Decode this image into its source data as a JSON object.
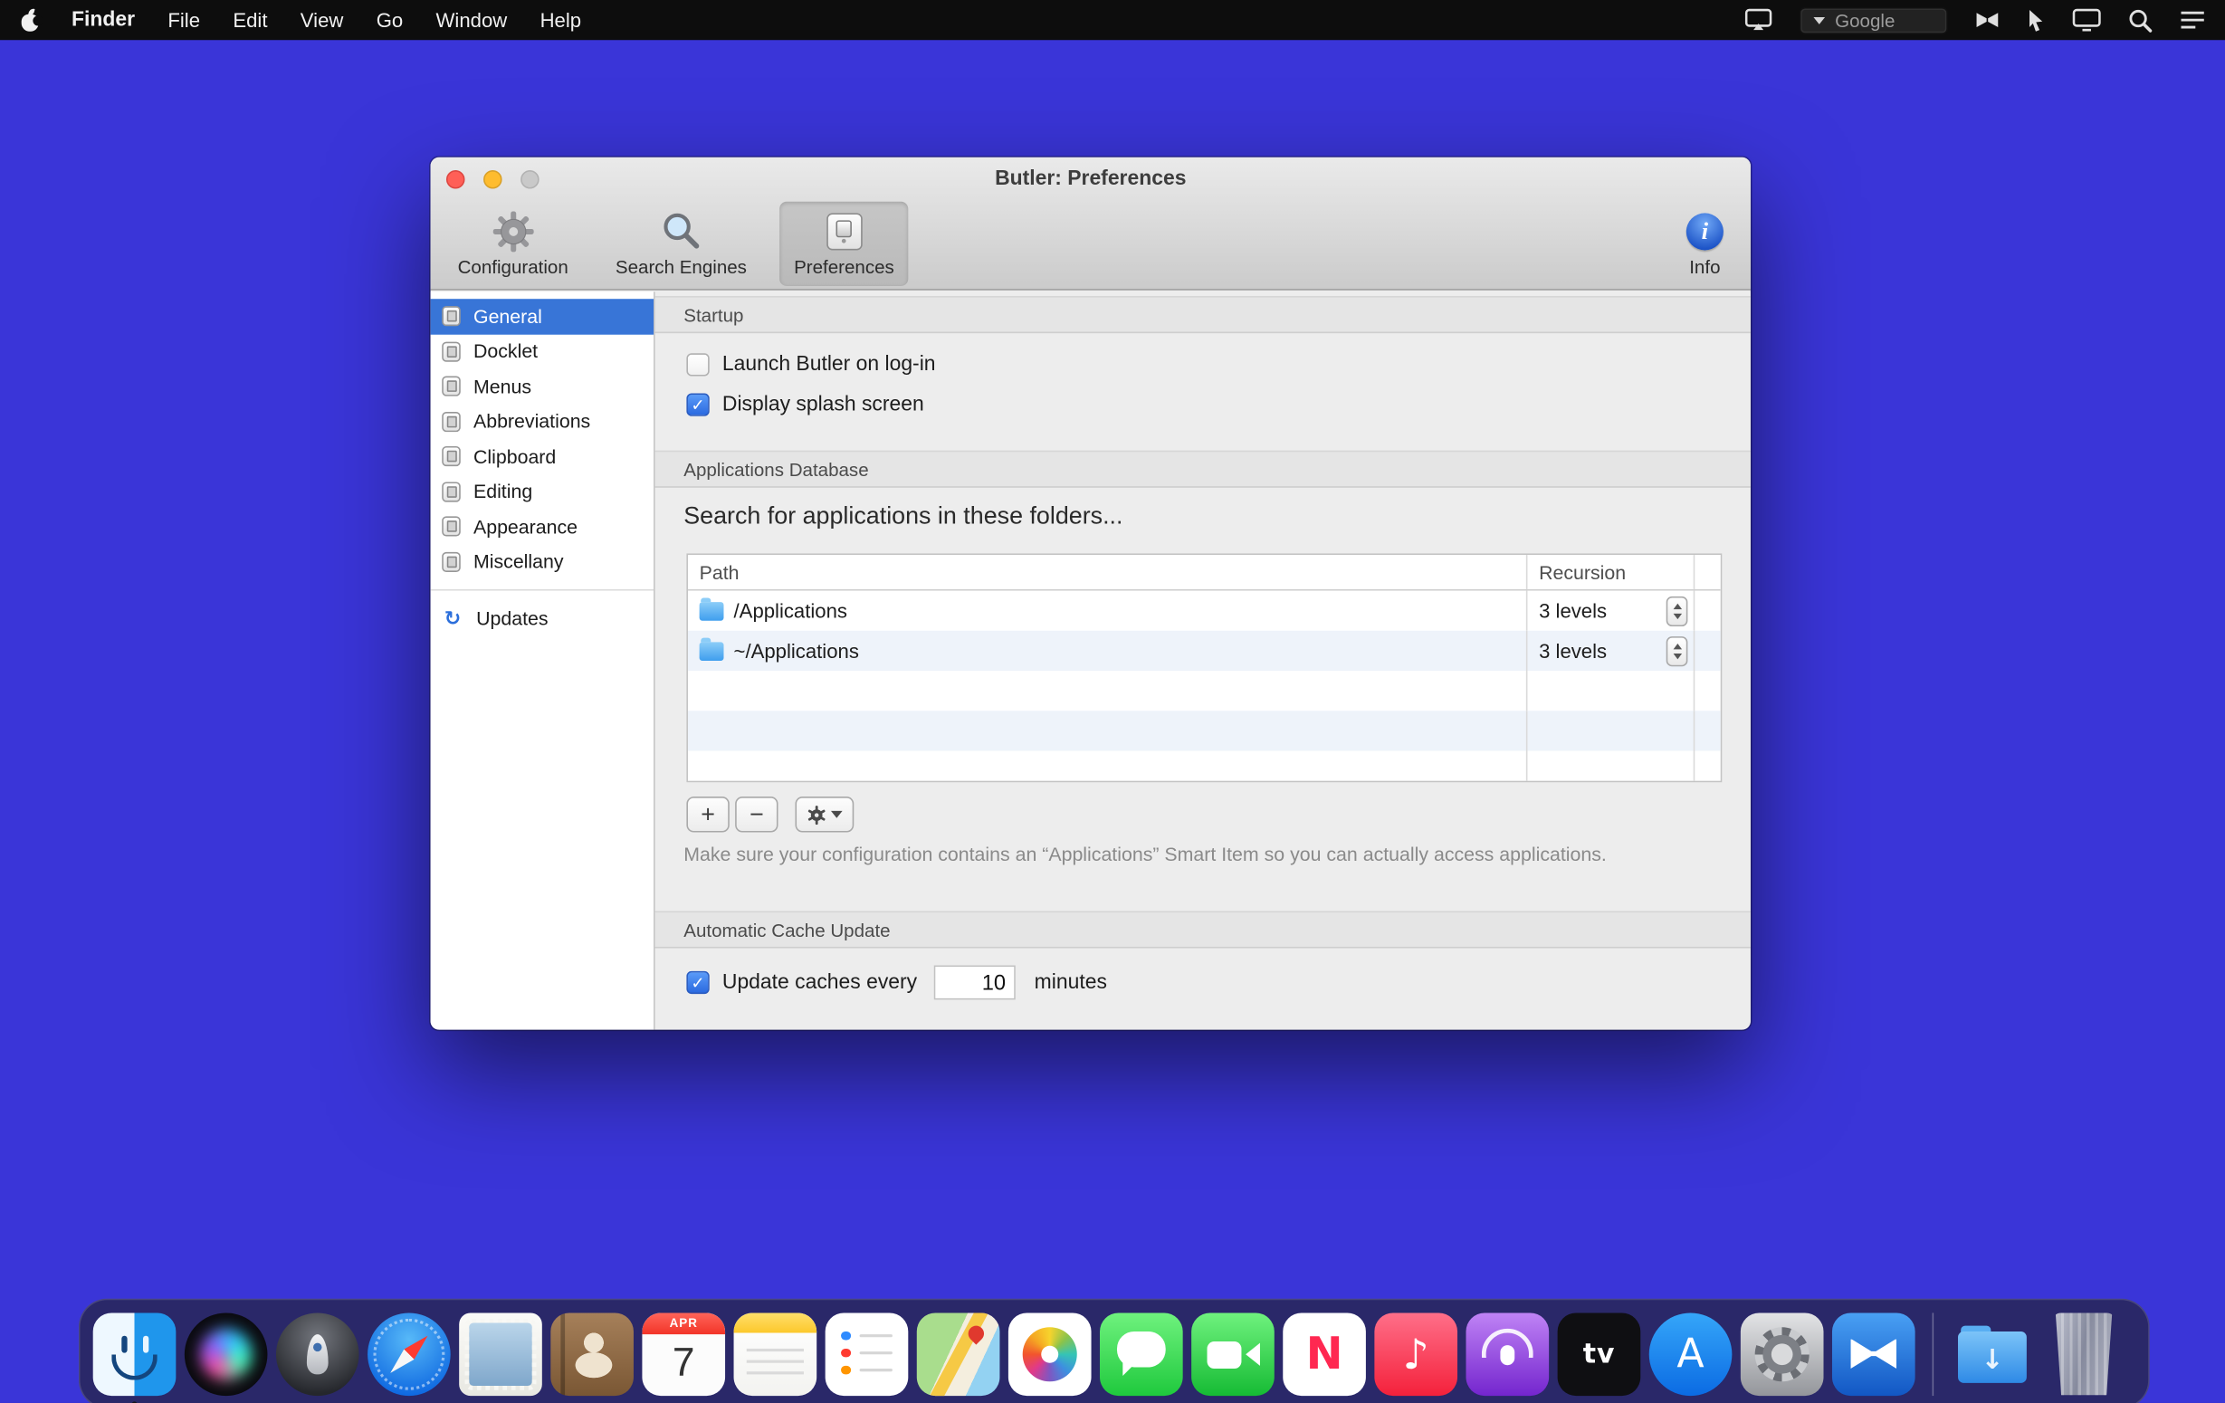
{
  "menubar": {
    "app_name": "Finder",
    "menus": [
      "File",
      "Edit",
      "View",
      "Go",
      "Window",
      "Help"
    ],
    "search_engine": "Google"
  },
  "prefs_window": {
    "title": "Butler: Preferences",
    "toolbar": {
      "configuration": "Configuration",
      "search_engines": "Search Engines",
      "preferences": "Preferences",
      "info": "Info"
    },
    "sidebar": {
      "items": [
        "General",
        "Docklet",
        "Menus",
        "Abbreviations",
        "Clipboard",
        "Editing",
        "Appearance",
        "Miscellany"
      ],
      "selected": "General",
      "updates": "Updates"
    },
    "startup": {
      "title": "Startup",
      "launch_checkbox": "Launch Butler on log-in",
      "launch_checked": false,
      "splash_checkbox": "Display splash screen",
      "splash_checked": true
    },
    "apps_db": {
      "title": "Applications Database",
      "heading": "Search for applications in these folders...",
      "columns": [
        "Path",
        "Recursion"
      ],
      "rows": [
        {
          "path": "/Applications",
          "recursion": "3 levels"
        },
        {
          "path": "~/Applications",
          "recursion": "3 levels"
        }
      ],
      "add": "+",
      "remove": "−",
      "note": "Make sure your configuration contains an “Applications” Smart Item so you can actually access applications."
    },
    "cache": {
      "title": "Automatic Cache Update",
      "label": "Update caches every",
      "value": "10",
      "suffix": "minutes",
      "checked": true
    }
  },
  "dock": {
    "apps": [
      {
        "name": "Finder",
        "running": true
      },
      {
        "name": "Siri"
      },
      {
        "name": "Launchpad"
      },
      {
        "name": "Safari"
      },
      {
        "name": "Mail"
      },
      {
        "name": "Contacts"
      },
      {
        "name": "Calendar",
        "month": "APR",
        "day": "7"
      },
      {
        "name": "Notes"
      },
      {
        "name": "Reminders"
      },
      {
        "name": "Maps"
      },
      {
        "name": "Photos"
      },
      {
        "name": "Messages"
      },
      {
        "name": "FaceTime"
      },
      {
        "name": "News",
        "glyph": "N"
      },
      {
        "name": "Music",
        "glyph": "♪"
      },
      {
        "name": "Podcasts"
      },
      {
        "name": "TV",
        "glyph": "tv"
      },
      {
        "name": "App Store",
        "glyph": "A"
      },
      {
        "name": "System Preferences"
      },
      {
        "name": "Butler"
      },
      {
        "name": "Downloads",
        "glyph": "↓"
      },
      {
        "name": "Trash"
      }
    ]
  }
}
